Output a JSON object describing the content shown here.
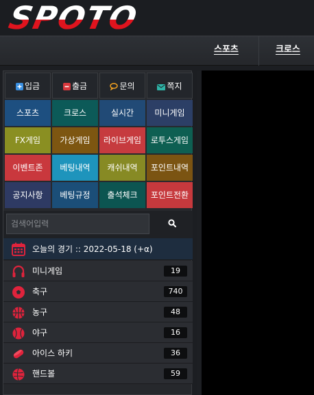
{
  "logo": {
    "text": "SPOTO"
  },
  "nav": {
    "items": [
      "스포츠",
      "크로스"
    ]
  },
  "quick_menu": {
    "top": [
      {
        "label": "입금",
        "icon": "plus-square-icon"
      },
      {
        "label": "출금",
        "icon": "minus-square-icon"
      },
      {
        "label": "문의",
        "icon": "chat-bubble-icon"
      },
      {
        "label": "쪽지",
        "icon": "envelope-icon"
      }
    ],
    "rows": [
      [
        {
          "label": "스포츠",
          "color": "#1d4f80"
        },
        {
          "label": "크로스",
          "color": "#0c5a58"
        },
        {
          "label": "실시간",
          "color": "#214a76"
        },
        {
          "label": "미니게임",
          "color": "#2c3f66"
        }
      ],
      [
        {
          "label": "FX게임",
          "color": "#8a8f22"
        },
        {
          "label": "가상게임",
          "color": "#7d5611"
        },
        {
          "label": "라이브게임",
          "color": "#c63b3f"
        },
        {
          "label": "로투스게임",
          "color": "#0e5f52"
        }
      ],
      [
        {
          "label": "이벤트존",
          "color": "#c9383d"
        },
        {
          "label": "베팅내역",
          "color": "#1e94bc"
        },
        {
          "label": "캐쉬내역",
          "color": "#878a24"
        },
        {
          "label": "포인트내역",
          "color": "#7b5412"
        }
      ],
      [
        {
          "label": "공지사항",
          "color": "#2e3a63"
        },
        {
          "label": "베팅규정",
          "color": "#1b4e78"
        },
        {
          "label": "출석체크",
          "color": "#0c5551"
        },
        {
          "label": "포인트전환",
          "color": "#c6393d"
        }
      ]
    ]
  },
  "search": {
    "placeholder": "검색어입력",
    "icon": "search-icon"
  },
  "today": {
    "label": "오늘의 경기 :: 2022-05-18 (+α)",
    "icon": "calendar-icon"
  },
  "sports": [
    {
      "label": "미니게임",
      "count": "19",
      "icon": "headset-icon"
    },
    {
      "label": "축구",
      "count": "740",
      "icon": "soccer-ball-icon"
    },
    {
      "label": "농구",
      "count": "48",
      "icon": "basketball-icon"
    },
    {
      "label": "야구",
      "count": "16",
      "icon": "baseball-icon"
    },
    {
      "label": "아이스 하키",
      "count": "36",
      "icon": "hockey-puck-icon"
    },
    {
      "label": "핸드볼",
      "count": "59",
      "icon": "handball-icon"
    }
  ],
  "colors": {
    "accent_red": "#e0141e",
    "today_bar": "#1e2d3f"
  }
}
